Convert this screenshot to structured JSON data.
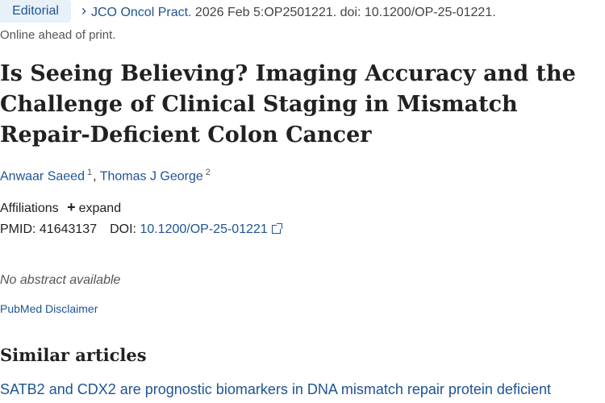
{
  "badge": "Editorial",
  "citation": {
    "chevron": "›",
    "journal": "JCO Oncol Pract.",
    "rest": " 2026 Feb 5:OP2501221. doi: 10.1200/OP-25-01221."
  },
  "ahead_of_print": "Online ahead of print.",
  "title": "Is Seeing Believing? Imaging Accuracy and the Challenge of Clinical Staging in Mismatch Repair-Deficient Colon Cancer",
  "authors": [
    {
      "name": "Anwaar Saeed",
      "sup": "1"
    },
    {
      "name": "Thomas J George",
      "sup": "2"
    }
  ],
  "affiliations": {
    "label": "Affiliations",
    "expand": "expand",
    "plus": "+"
  },
  "ids": {
    "pmid_label": "PMID:",
    "pmid": "41643137",
    "doi_label": "DOI:",
    "doi": "10.1200/OP-25-01221"
  },
  "no_abstract": "No abstract available",
  "disclaimer": "PubMed Disclaimer",
  "similar_heading": "Similar articles",
  "similar_first": "SATB2 and CDX2 are prognostic biomarkers in DNA mismatch repair protein deficient"
}
